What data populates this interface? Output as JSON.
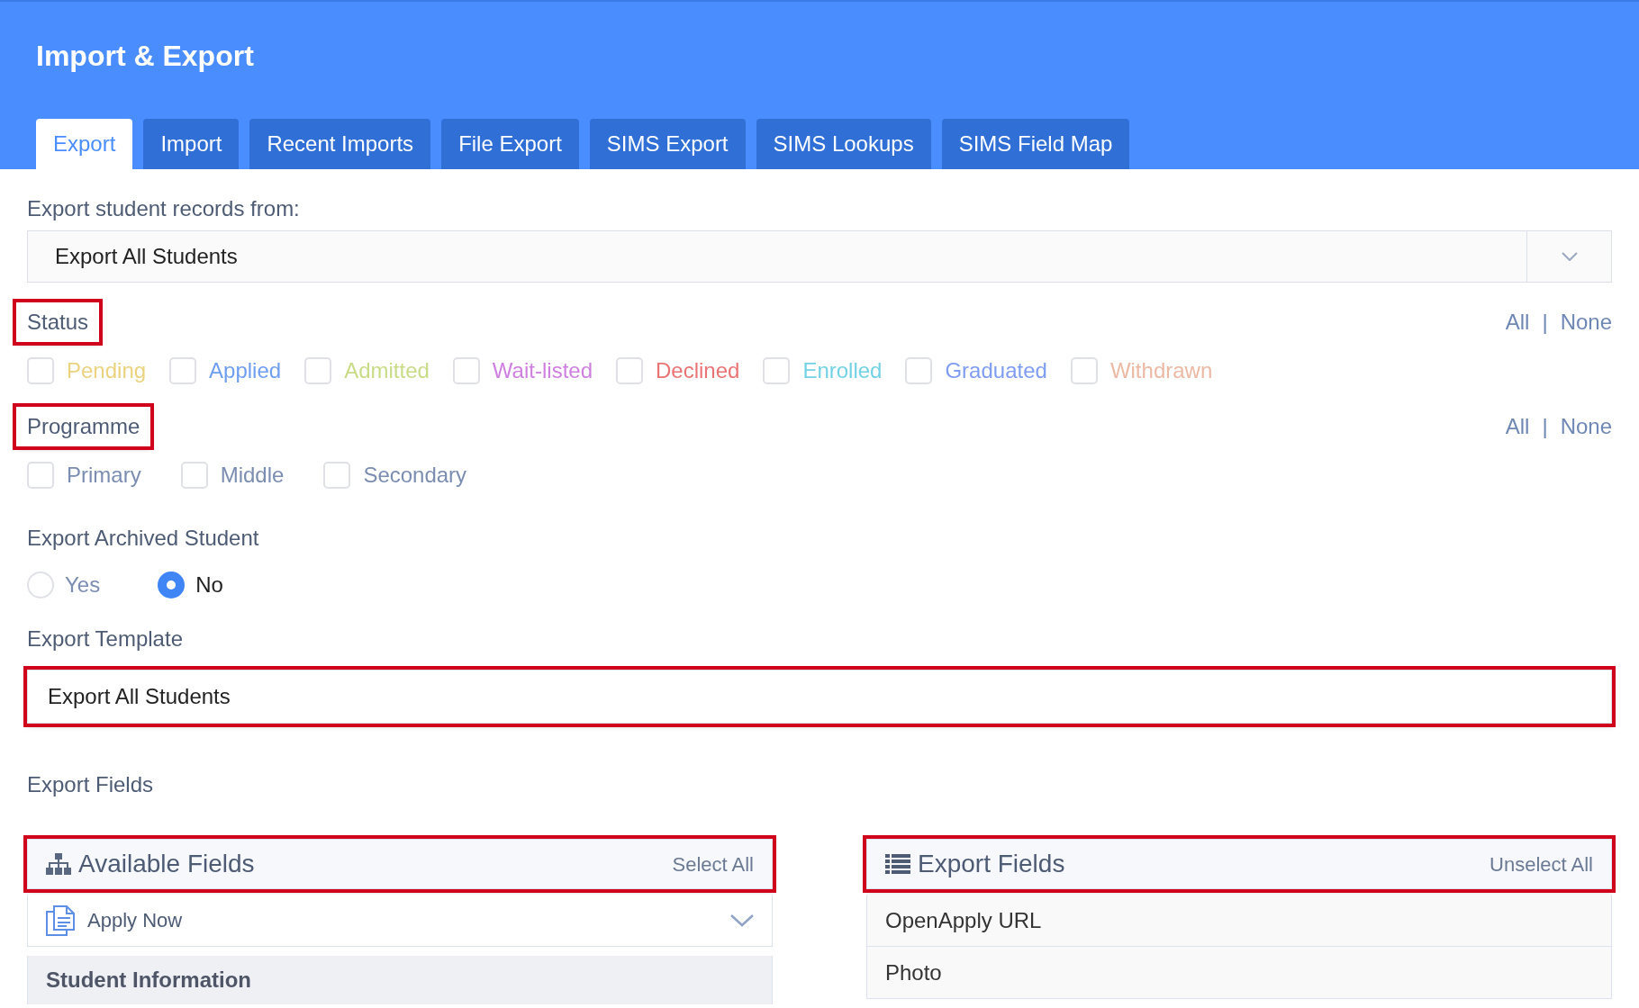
{
  "header": {
    "title": "Import & Export"
  },
  "tabs": [
    {
      "label": "Export",
      "selected": true
    },
    {
      "label": "Import",
      "selected": false
    },
    {
      "label": "Recent Imports",
      "selected": false
    },
    {
      "label": "File Export",
      "selected": false
    },
    {
      "label": "SIMS Export",
      "selected": false
    },
    {
      "label": "SIMS Lookups",
      "selected": false
    },
    {
      "label": "SIMS Field Map",
      "selected": false
    }
  ],
  "records_from": {
    "label": "Export student records from:",
    "value": "Export All Students"
  },
  "status": {
    "label": "Status",
    "highlighted": true,
    "all": "All",
    "separator": "|",
    "none": "None",
    "options": [
      {
        "label": "Pending",
        "checked": false,
        "color": "#ead27e"
      },
      {
        "label": "Applied",
        "checked": false,
        "color": "#6f9ef0"
      },
      {
        "label": "Admitted",
        "checked": false,
        "color": "#c8dc87"
      },
      {
        "label": "Wait-listed",
        "checked": false,
        "color": "#cf7fe0"
      },
      {
        "label": "Declined",
        "checked": false,
        "color": "#ea7474"
      },
      {
        "label": "Enrolled",
        "checked": false,
        "color": "#72d2e4"
      },
      {
        "label": "Graduated",
        "checked": false,
        "color": "#7f9df0"
      },
      {
        "label": "Withdrawn",
        "checked": false,
        "color": "#ebb9a4"
      }
    ]
  },
  "programme": {
    "label": "Programme",
    "highlighted": true,
    "all": "All",
    "separator": "|",
    "none": "None",
    "options": [
      {
        "label": "Primary",
        "checked": false
      },
      {
        "label": "Middle",
        "checked": false
      },
      {
        "label": "Secondary",
        "checked": false
      }
    ]
  },
  "archived": {
    "label": "Export Archived Student",
    "options": [
      {
        "label": "Yes",
        "selected": false
      },
      {
        "label": "No",
        "selected": true
      }
    ]
  },
  "template": {
    "label": "Export Template",
    "value": "Export All Students",
    "highlighted": true
  },
  "export_fields_label": "Export Fields",
  "available_panel": {
    "title": "Available Fields",
    "action": "Select All",
    "highlighted": true,
    "group": "Apply Now",
    "section": "Student Information"
  },
  "export_panel": {
    "title": "Export Fields",
    "action": "Unselect All",
    "highlighted": true,
    "items": [
      "OpenApply URL",
      "Photo"
    ]
  }
}
